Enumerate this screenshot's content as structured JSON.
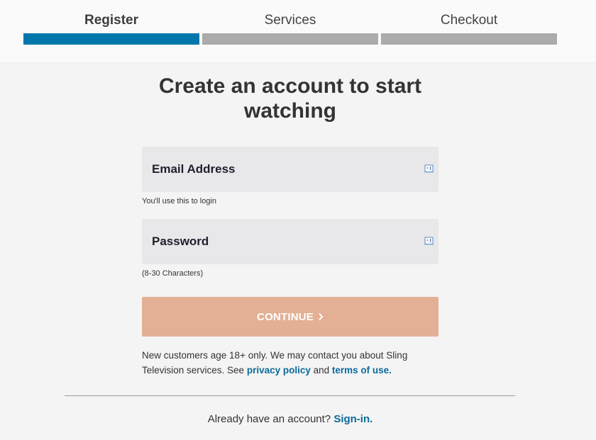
{
  "stepper": {
    "steps": [
      {
        "label": "Register",
        "active": true
      },
      {
        "label": "Services",
        "active": false
      },
      {
        "label": "Checkout",
        "active": false
      }
    ],
    "active_color": "#0077ab",
    "inactive_color": "#ababab"
  },
  "form": {
    "title": "Create an account to start watching",
    "email": {
      "placeholder": "Email Address",
      "value": "",
      "hint": "You'll use this to login",
      "icon": "autofill-card-icon"
    },
    "password": {
      "placeholder": "Password",
      "value": "",
      "hint": "(8-30 Characters)",
      "icon": "autofill-card-icon"
    },
    "continue_label": "CONTINUE",
    "continue_icon": "chevron-right-icon",
    "continue_color": "#e3b095"
  },
  "legal": {
    "text_before": "New customers age 18+ only. We may contact you about Sling Television services. See ",
    "privacy_link": "privacy policy",
    "and_text": " and ",
    "terms_link": "terms of use."
  },
  "signin": {
    "prompt": "Already have an account? ",
    "link": "Sign-in."
  },
  "link_color": "#0a6b9c"
}
